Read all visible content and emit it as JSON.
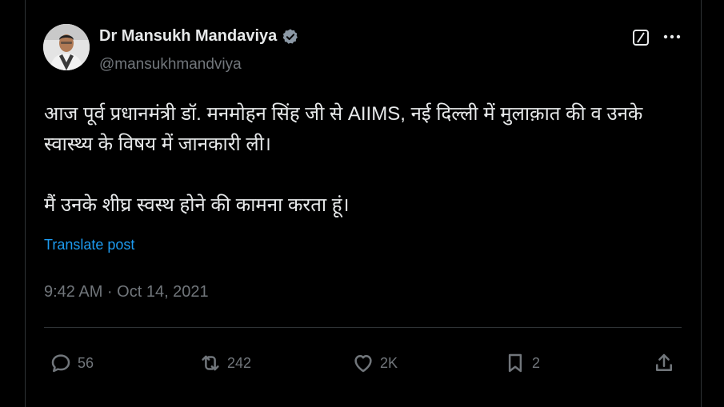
{
  "author": {
    "display_name": "Dr Mansukh Mandaviya",
    "handle": "@mansukhmandviya",
    "verified": true
  },
  "tweet": {
    "line1": "आज पूर्व प्रधानमंत्री डॉ. मनमोहन सिंह जी से AIIMS, नई दिल्ली में मुलाक़ात की व उनके",
    "line2": "स्वास्थ्य के विषय में जानकारी ली।",
    "line3": "मैं उनके शीघ्र स्वस्थ होने की कामना करता हूं।",
    "translate_label": "Translate post",
    "timestamp": "9:42 AM · Oct 14, 2021"
  },
  "actions": {
    "replies": "56",
    "reposts": "242",
    "likes": "2K",
    "bookmarks": "2"
  },
  "icons": {
    "verified": "verified-badge-icon",
    "grok": "grok-icon",
    "more": "more-icon",
    "reply": "reply-icon",
    "repost": "repost-icon",
    "like": "heart-icon",
    "bookmark": "bookmark-icon",
    "share": "share-icon"
  },
  "colors": {
    "background": "#000000",
    "text": "#e7e9ea",
    "muted": "#71767b",
    "link": "#1d9bf0",
    "border": "#2f3336"
  }
}
